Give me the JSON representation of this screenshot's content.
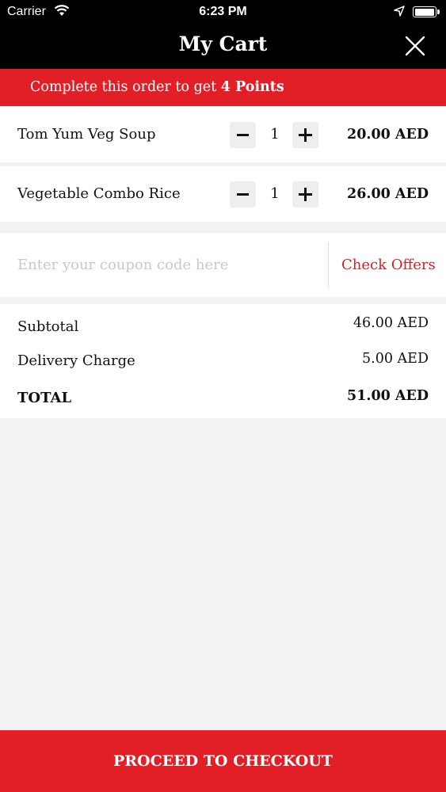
{
  "status_bar": {
    "carrier": "Carrier",
    "time": "6:23 PM"
  },
  "header": {
    "title": "My Cart"
  },
  "promo": {
    "text": "Complete this order to get ",
    "points": "4 Points"
  },
  "cart_items": [
    {
      "name": "Tom Yum Veg Soup",
      "quantity": "1",
      "price": "20.00 AED"
    },
    {
      "name": "Vegetable Combo Rice",
      "quantity": "1",
      "price": "26.00 AED"
    }
  ],
  "coupon": {
    "placeholder": "Enter your coupon code here",
    "value": "",
    "offers_label": "Check Offers"
  },
  "summary": {
    "subtotal_label": "Subtotal",
    "subtotal_value": "46.00 AED",
    "delivery_label": "Delivery Charge",
    "delivery_value": "5.00 AED",
    "total_label": "TOTAL",
    "total_value": "51.00 AED"
  },
  "checkout": {
    "label": "PROCEED TO CHECKOUT"
  },
  "colors": {
    "accent": "#e21f26",
    "header_bg": "#000000",
    "page_bg": "#f2f2f4"
  },
  "icons": [
    "wifi-icon",
    "location-arrow-icon",
    "battery-icon",
    "close-icon",
    "minus-icon",
    "plus-icon"
  ]
}
